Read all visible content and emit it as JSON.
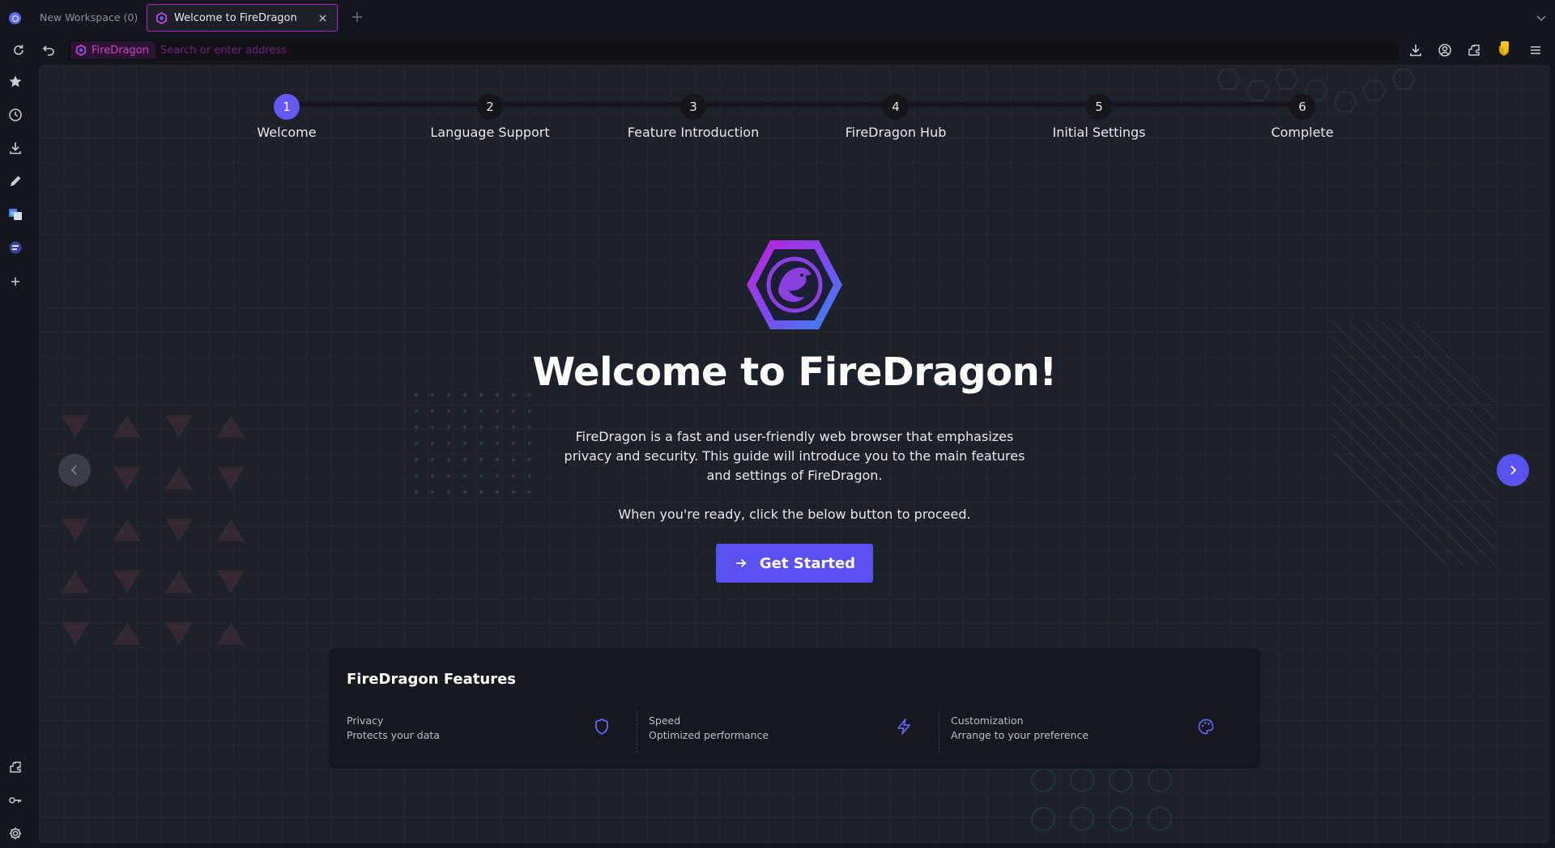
{
  "colors": {
    "accent": "#5a52f0",
    "tab_border": "#b322d0",
    "identity_text": "#d13fc9",
    "background": "#1d2129"
  },
  "tabs": [
    {
      "label": "New Workspace (0)",
      "active": false
    },
    {
      "label": "Welcome to FireDragon",
      "active": true
    }
  ],
  "urlbar": {
    "identity_label": "FireDragon",
    "placeholder": "Search or enter address"
  },
  "steps": [
    {
      "number": "1",
      "label": "Welcome",
      "active": true
    },
    {
      "number": "2",
      "label": "Language Support",
      "active": false
    },
    {
      "number": "3",
      "label": "Feature Introduction",
      "active": false
    },
    {
      "number": "4",
      "label": "FireDragon Hub",
      "active": false
    },
    {
      "number": "5",
      "label": "Initial Settings",
      "active": false
    },
    {
      "number": "6",
      "label": "Complete",
      "active": false
    }
  ],
  "hero": {
    "title": "Welcome to FireDragon!",
    "description": "FireDragon is a fast and user-friendly web browser that emphasizes privacy and security. This guide will introduce you to the main features and settings of FireDragon.",
    "ready_text": "When you're ready, click the below button to proceed.",
    "start_label": "Get Started"
  },
  "features": {
    "title": "FireDragon Features",
    "items": [
      {
        "name": "Privacy",
        "desc": "Protects your data",
        "icon": "shield-icon"
      },
      {
        "name": "Speed",
        "desc": "Optimized performance",
        "icon": "lightning-icon"
      },
      {
        "name": "Customization",
        "desc": "Arrange to your preference",
        "icon": "palette-icon"
      }
    ]
  },
  "icons": {
    "toolbar": [
      "reload-icon",
      "back-icon",
      "downloads-icon",
      "account-icon",
      "extensions-icon",
      "extension-badge-icon",
      "menu-icon"
    ],
    "sidebar": [
      "bookmarks-icon",
      "history-icon",
      "downloads-icon",
      "notes-icon",
      "translate-icon",
      "firedragon-icon",
      "add-panel-icon",
      "extensions-icon",
      "passwords-icon",
      "settings-icon"
    ]
  }
}
